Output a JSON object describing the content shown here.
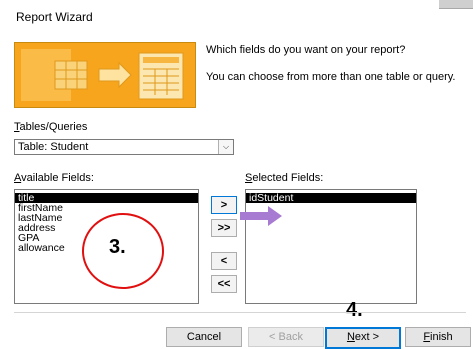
{
  "window": {
    "title": "Report Wizard"
  },
  "intro": {
    "question": "Which fields do you want on your report?",
    "hint": "You can choose from more than one table or query."
  },
  "tables_queries": {
    "label_prefix": "",
    "label_underlined": "T",
    "label_rest": "ables/Queries",
    "selected_value": "Table: Student"
  },
  "available_fields": {
    "label_underlined": "A",
    "label_rest": "vailable Fields:",
    "items": [
      "title",
      "firstName",
      "lastName",
      "address",
      "GPA",
      "allowance"
    ],
    "selected_index": 0
  },
  "selected_fields": {
    "label_underlined": "S",
    "label_rest": "elected Fields:",
    "items": [
      "idStudent"
    ],
    "selected_index": 0
  },
  "move_buttons": {
    "add_one": ">",
    "add_all": ">>",
    "remove_one": "<",
    "remove_all": "<<"
  },
  "footer": {
    "cancel": "Cancel",
    "back": "< Back",
    "next_underlined": "N",
    "next_rest": "ext >",
    "finish_underlined": "F",
    "finish_rest": "inish"
  },
  "annotations": {
    "step3": "3.",
    "step4": "4."
  },
  "colors": {
    "banner": "#f7a51c",
    "selection": "#000000",
    "focus_border": "#0078d7",
    "annotation_circle": "#e01010",
    "annotation_arrow": "#a77bd1"
  }
}
